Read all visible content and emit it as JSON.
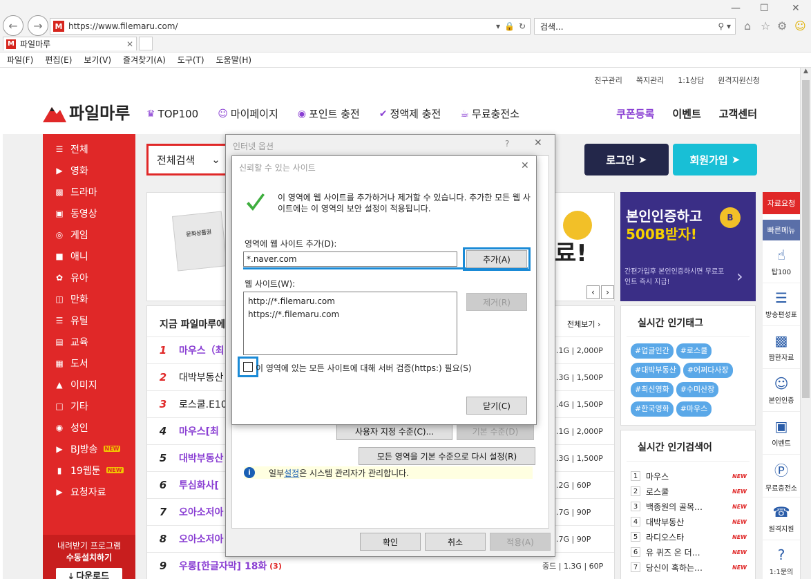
{
  "browser": {
    "url": "https://www.filemaru.com/",
    "search_placeholder": "검색...",
    "tab_title": "파일마루",
    "menu": [
      "파일(F)",
      "편집(E)",
      "보기(V)",
      "즐겨찾기(A)",
      "도구(T)",
      "도움말(H)"
    ]
  },
  "site": {
    "top_links": [
      "친구관리",
      "쪽지관리",
      "1:1상담",
      "원격지원신청"
    ],
    "logo": "파일마루",
    "gnb": [
      "TOP100",
      "마이페이지",
      "포인트 충전",
      "정액제 충전",
      "무료충전소"
    ],
    "gnb_right": [
      "쿠폰등록",
      "이벤트",
      "고객센터"
    ],
    "search_category": "전체검색",
    "login": "로그인",
    "join": "회원가입",
    "sidebar": [
      "전체",
      "영화",
      "드라마",
      "동영상",
      "게임",
      "애니",
      "유아",
      "만화",
      "유틸",
      "교육",
      "도서",
      "이미지",
      "기타",
      "성인",
      "BJ방송",
      "19웹툰",
      "요청자료"
    ],
    "new_badge": "NEW",
    "download_text1": "내려받기 프로그램",
    "download_text2": "수동설치하기",
    "download_btn": "다운로드",
    "banner1_fragment": "료!",
    "voucher": "문화상품권",
    "banner2_line1": "본인인증하고",
    "banner2_line2": "500B받자!",
    "banner2_sub": "간편가입후 본인인증하시면 무료포인트 즉시 지급!",
    "ranking_title": "지금 파일마루에",
    "ranking_more": "전체보기",
    "ranking": [
      {
        "n": "1",
        "title": "마우스（최",
        "size": "2.1G | 2,000P",
        "color": "#8a3fd3"
      },
      {
        "n": "2",
        "title": "대박부동산",
        "size": "1.3G | 1,500P",
        "color": "#222"
      },
      {
        "n": "3",
        "title": "로스쿨.E10",
        "size": "1.4G | 1,500P",
        "color": "#222"
      },
      {
        "n": "4",
        "title": "마우스[최",
        "size": "2.1G | 2,000P",
        "color": "#8a3fd3"
      },
      {
        "n": "5",
        "title": "대박부동산",
        "size": "2.3G | 1,500P",
        "color": "#8a3fd3"
      },
      {
        "n": "6",
        "title": "투심화사[",
        "size": "1.2G | 60P",
        "color": "#8a3fd3"
      },
      {
        "n": "7",
        "title": "오아소저아",
        "size": "1.7G | 90P",
        "color": "#8a3fd3"
      },
      {
        "n": "8",
        "title": "오아소저아",
        "size": "1.7G | 90P",
        "color": "#8a3fd3"
      },
      {
        "n": "9",
        "title": "우롱[한글자막] 18화",
        "count": "(3)",
        "size": "중드 | 1.3G | 60P",
        "color": "#8a3fd3"
      }
    ],
    "tags_title": "실시간 인기태그",
    "tags": [
      "#업글인간",
      "#로스쿨",
      "#대박부동산",
      "#어쩌다사장",
      "#최신영화",
      "#수미산장",
      "#한국영화",
      "#마우스"
    ],
    "kw_title": "실시간 인기검색어",
    "keywords": [
      "마우스",
      "로스쿨",
      "백종원의 골목…",
      "대박부동산",
      "라디오스타",
      "유 퀴즈 온 더…",
      "당신이 혹하는…"
    ],
    "right_side": {
      "top": "자료요청",
      "sub": "빠른메뉴",
      "items": [
        "탑100",
        "방송편성표",
        "짬한자료",
        "본인인증",
        "이벤트",
        "무료충전소",
        "원격지원",
        "1:1문의"
      ]
    }
  },
  "internet_options": {
    "title": "인터넷 옵션",
    "help": "?",
    "btn_custom": "사용자 지정 수준(C)...",
    "btn_default": "기본 수준(D)",
    "btn_reset": "모든 영역을 기본 수준으로 다시 설정(R)",
    "admin_prefix": "일부 ",
    "admin_link": "설정",
    "admin_suffix": "은 시스템 관리자가 관리합니다.",
    "ok": "확인",
    "cancel": "취소",
    "apply": "적용(A)"
  },
  "trusted_sites": {
    "title": "신뢰할 수 있는 사이트",
    "info": "이 영역에 웹 사이트를 추가하거나 제거할 수 있습니다. 추가한 모든 웹 사이트에는 이 영역의 보안 설정이 적용됩니다.",
    "add_label": "영역에 웹 사이트 추가(D):",
    "add_value": "*.naver.com",
    "add_btn": "추가(A)",
    "sites_label": "웹 사이트(W):",
    "sites": [
      "http://*.filemaru.com",
      "https://*.filemaru.com"
    ],
    "remove_btn": "제거(R)",
    "https_label": "이 영역에 있는 모든 사이트에 대해 서버 검증(https:) 필요(S)",
    "close_btn": "닫기(C)",
    "accent": "#1a8ad6"
  }
}
